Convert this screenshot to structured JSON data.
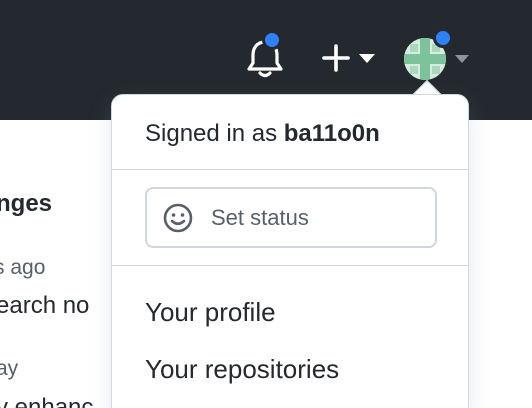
{
  "header": {
    "bell_icon": "bell-icon",
    "plus_icon": "plus-icon",
    "avatar_icon": "identicon-avatar",
    "notification_color": "#2f81f7",
    "background_color": "#24292f"
  },
  "page": {
    "heading_fragment": "nges",
    "time_fragment_1": "s ago",
    "line_fragment_1": "earch no",
    "time_fragment_2": "ay",
    "line_fragment_2": "y enhanc"
  },
  "menu": {
    "signed_in_prefix": "Signed in as",
    "username": "ba11o0n",
    "status_icon": "smiley-icon",
    "status_label": "Set status",
    "items": [
      {
        "label": "Your profile"
      },
      {
        "label": "Your repositories"
      }
    ]
  }
}
